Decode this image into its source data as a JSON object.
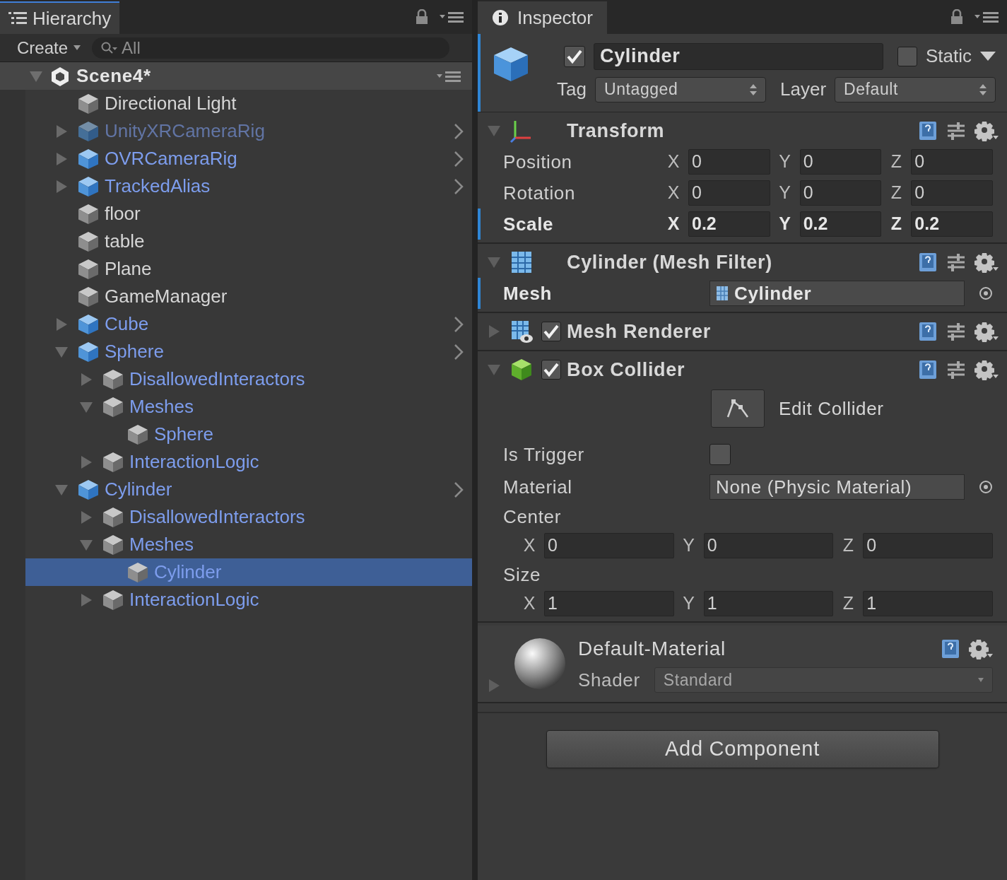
{
  "hierarchy": {
    "tab": "Hierarchy",
    "create": "Create",
    "search": {
      "placeholder": "All"
    },
    "scene": {
      "label": "Scene4*",
      "expanded": true
    },
    "items": [
      {
        "label": "Directional Light",
        "kind": "object",
        "selected": false
      },
      {
        "label": "UnityXRCameraRig",
        "kind": "prefab_root",
        "expanded": false,
        "inactive": true,
        "selected": false
      },
      {
        "label": "OVRCameraRig",
        "kind": "prefab_root",
        "expanded": false,
        "selected": false
      },
      {
        "label": "TrackedAlias",
        "kind": "prefab_root",
        "expanded": false,
        "selected": false
      },
      {
        "label": "floor",
        "kind": "object",
        "selected": false
      },
      {
        "label": "table",
        "kind": "object",
        "selected": false
      },
      {
        "label": "Plane",
        "kind": "object",
        "selected": false
      },
      {
        "label": "GameManager",
        "kind": "object",
        "selected": false
      },
      {
        "label": "Cube",
        "kind": "prefab_root",
        "expanded": false,
        "selected": false
      },
      {
        "label": "Sphere",
        "kind": "prefab_root",
        "expanded": true,
        "selected": false,
        "children": [
          {
            "label": "DisallowedInteractors",
            "kind": "prefab_child",
            "expanded": false,
            "selected": false
          },
          {
            "label": "Meshes",
            "kind": "prefab_child",
            "expanded": true,
            "selected": false,
            "children": [
              {
                "label": "Sphere",
                "kind": "prefab_child",
                "selected": false
              }
            ]
          },
          {
            "label": "InteractionLogic",
            "kind": "prefab_child",
            "expanded": false,
            "selected": false
          }
        ]
      },
      {
        "label": "Cylinder",
        "kind": "prefab_root",
        "expanded": true,
        "selected": false,
        "children": [
          {
            "label": "DisallowedInteractors",
            "kind": "prefab_child",
            "expanded": false,
            "selected": false
          },
          {
            "label": "Meshes",
            "kind": "prefab_child",
            "expanded": true,
            "selected": false,
            "children": [
              {
                "label": "Cylinder",
                "kind": "prefab_child",
                "selected": true
              }
            ]
          },
          {
            "label": "InteractionLogic",
            "kind": "prefab_child",
            "expanded": false,
            "selected": false
          }
        ]
      }
    ]
  },
  "inspector": {
    "tab": "Inspector",
    "object": {
      "active": true,
      "name": "Cylinder",
      "static_label": "Static",
      "static": false,
      "tag_label": "Tag",
      "tag": "Untagged",
      "layer_label": "Layer",
      "layer": "Default",
      "overridden": true
    },
    "components": [
      {
        "name": "Transform",
        "kind": "transform",
        "expanded": true,
        "properties": [
          {
            "kind": "vector3",
            "label": "Position",
            "overridden": false,
            "axes": [
              {
                "axis": "X",
                "value": "0"
              },
              {
                "axis": "Y",
                "value": "0"
              },
              {
                "axis": "Z",
                "value": "0"
              }
            ]
          },
          {
            "kind": "vector3",
            "label": "Rotation",
            "overridden": false,
            "axes": [
              {
                "axis": "X",
                "value": "0"
              },
              {
                "axis": "Y",
                "value": "0"
              },
              {
                "axis": "Z",
                "value": "0"
              }
            ]
          },
          {
            "kind": "vector3",
            "label": "Scale",
            "overridden": true,
            "axes": [
              {
                "axis": "X",
                "value": "0.2"
              },
              {
                "axis": "Y",
                "value": "0.2"
              },
              {
                "axis": "Z",
                "value": "0.2"
              }
            ]
          }
        ]
      },
      {
        "name": "Cylinder (Mesh Filter)",
        "kind": "mesh_filter",
        "expanded": true,
        "properties": [
          {
            "kind": "object_field",
            "label": "Mesh",
            "value": "Cylinder",
            "overridden": true
          }
        ]
      },
      {
        "name": "Mesh Renderer",
        "kind": "mesh_renderer",
        "expanded": false,
        "enabled": true
      },
      {
        "name": "Box Collider",
        "kind": "box_collider",
        "expanded": true,
        "enabled": true,
        "properties": [
          {
            "kind": "button",
            "label": "Edit Collider"
          },
          {
            "kind": "checkbox",
            "label": "Is Trigger",
            "checked": false
          },
          {
            "kind": "object_field",
            "label": "Material",
            "value": "None (Physic Material)",
            "overridden": false
          },
          {
            "kind": "vector3_below",
            "label": "Center",
            "axes": [
              {
                "axis": "X",
                "value": "0"
              },
              {
                "axis": "Y",
                "value": "0"
              },
              {
                "axis": "Z",
                "value": "0"
              }
            ]
          },
          {
            "kind": "vector3_below",
            "label": "Size",
            "axes": [
              {
                "axis": "X",
                "value": "1"
              },
              {
                "axis": "Y",
                "value": "1"
              },
              {
                "axis": "Z",
                "value": "1"
              }
            ]
          }
        ]
      }
    ],
    "material": {
      "name": "Default-Material",
      "shader_label": "Shader",
      "shader": "Standard",
      "expanded": false
    },
    "add_component": "Add Component"
  }
}
